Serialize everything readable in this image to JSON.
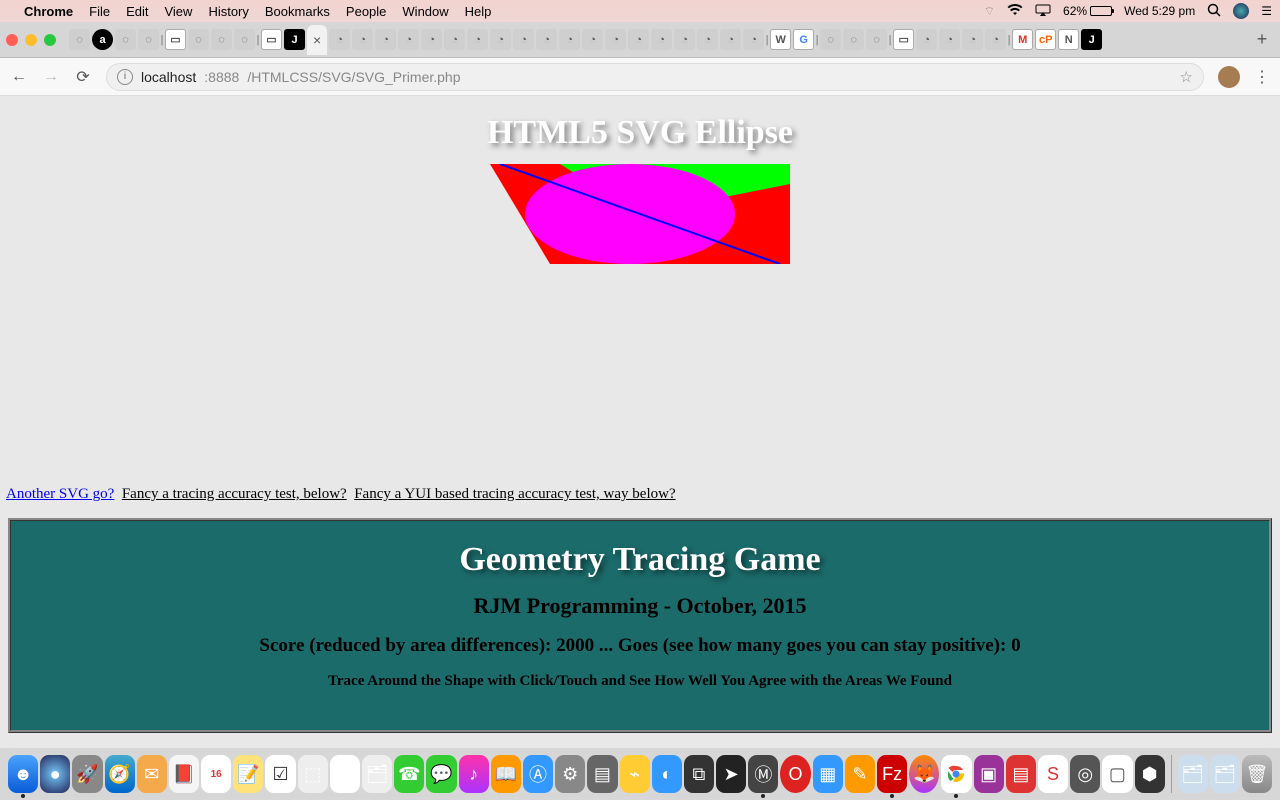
{
  "menubar": {
    "app": "Chrome",
    "items": [
      "File",
      "Edit",
      "View",
      "History",
      "Bookmarks",
      "People",
      "Window",
      "Help"
    ],
    "battery_pct": "62%",
    "clock": "Wed 5:29 pm"
  },
  "browser": {
    "url_host": "localhost",
    "url_port": ":8888",
    "url_path": "/HTMLCSS/SVG/SVG_Primer.php",
    "tab_plus": "+"
  },
  "page": {
    "svg_title": "HTML5 SVG Ellipse",
    "link_another": "Another SVG go?",
    "link_tracing": "Fancy a tracing accuracy test, below?",
    "link_yui": "Fancy a YUI based tracing accuracy test, way below?",
    "game_title": "Geometry Tracing Game",
    "game_sub": "RJM Programming - October, 2015",
    "score_line": "Score (reduced by area differences): 2000 ... Goes (see how many goes you can stay positive): 0",
    "instr": "Trace Around the Shape with Click/Touch and See How Well You Agree with the Areas We Found"
  },
  "dock": {
    "labels": [
      "finder",
      "siri",
      "launchpad",
      "safari",
      "mail",
      "contacts",
      "calendar",
      "notes",
      "reminders",
      "maps",
      "photos",
      "messages",
      "facetime",
      "music",
      "books",
      "appstore",
      "prefs",
      "terminal",
      "activity",
      "chess",
      "automator",
      "calc",
      "firefox",
      "chrome",
      "vscode",
      "mamp",
      "filezilla",
      "opera",
      "app1",
      "app2",
      "app3",
      "app4",
      "app5"
    ]
  }
}
